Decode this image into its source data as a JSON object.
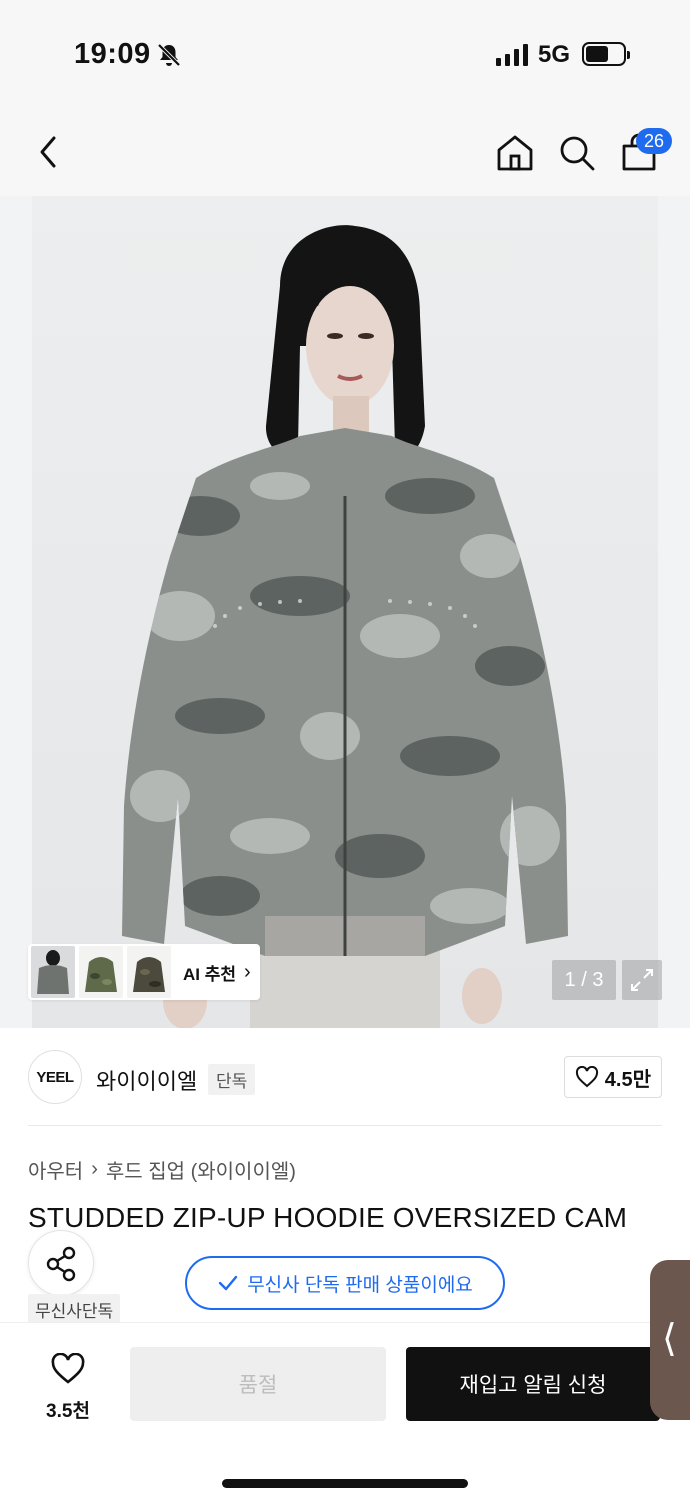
{
  "status": {
    "time": "19:09",
    "network": "5G",
    "battery_level": 0.6
  },
  "nav": {
    "cart_count": "26"
  },
  "gallery": {
    "counter": "1 / 3",
    "current_index": 1,
    "total": 3,
    "ai_recommend_label": "AI 추천"
  },
  "brand": {
    "logo_text": "YEEL",
    "name": "와이이이엘",
    "exclusive_tag": "단독",
    "likes": "4.5만"
  },
  "product": {
    "breadcrumb": [
      "아우터",
      "후드 집업 (와이이이엘)"
    ],
    "title": "STUDDED ZIP-UP HOODIE OVERSIZED CAM"
  },
  "badges": {
    "share_tag": "무신사단독",
    "exclusive_notice": "무신사 단독 판매 상품이에요"
  },
  "bottom": {
    "wish_count": "3.5천",
    "soldout_label": "품절",
    "restock_label": "재입고 알림 신청"
  },
  "colors": {
    "accent_blue": "#1f6bf0",
    "side_tab": "#6b574d",
    "camo_dark": "#5d6360",
    "camo_mid": "#8a8f8c",
    "camo_light": "#b4b8b5"
  }
}
